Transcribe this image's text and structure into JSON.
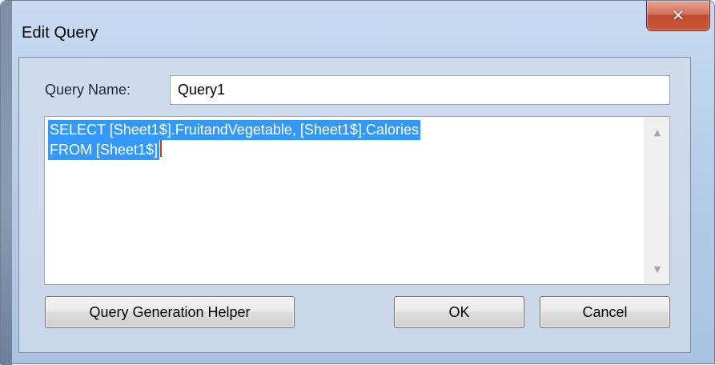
{
  "window": {
    "title": "Edit Query",
    "close_glyph": "✕"
  },
  "query_name": {
    "label": "Query Name:",
    "value": "Query1"
  },
  "sql": {
    "lines": [
      "SELECT [Sheet1$].FruitandVegetable, [Sheet1$].Calories",
      "FROM [Sheet1$]"
    ],
    "selected": true,
    "selection_color": "#3399ff"
  },
  "scrollbar": {
    "up_glyph": "▲",
    "down_glyph": "▼"
  },
  "buttons": {
    "helper_label": "Query Generation Helper",
    "ok_label": "OK",
    "cancel_label": "Cancel"
  },
  "colors": {
    "frame": "#b4cbe6",
    "close_button": "#c8583b"
  }
}
